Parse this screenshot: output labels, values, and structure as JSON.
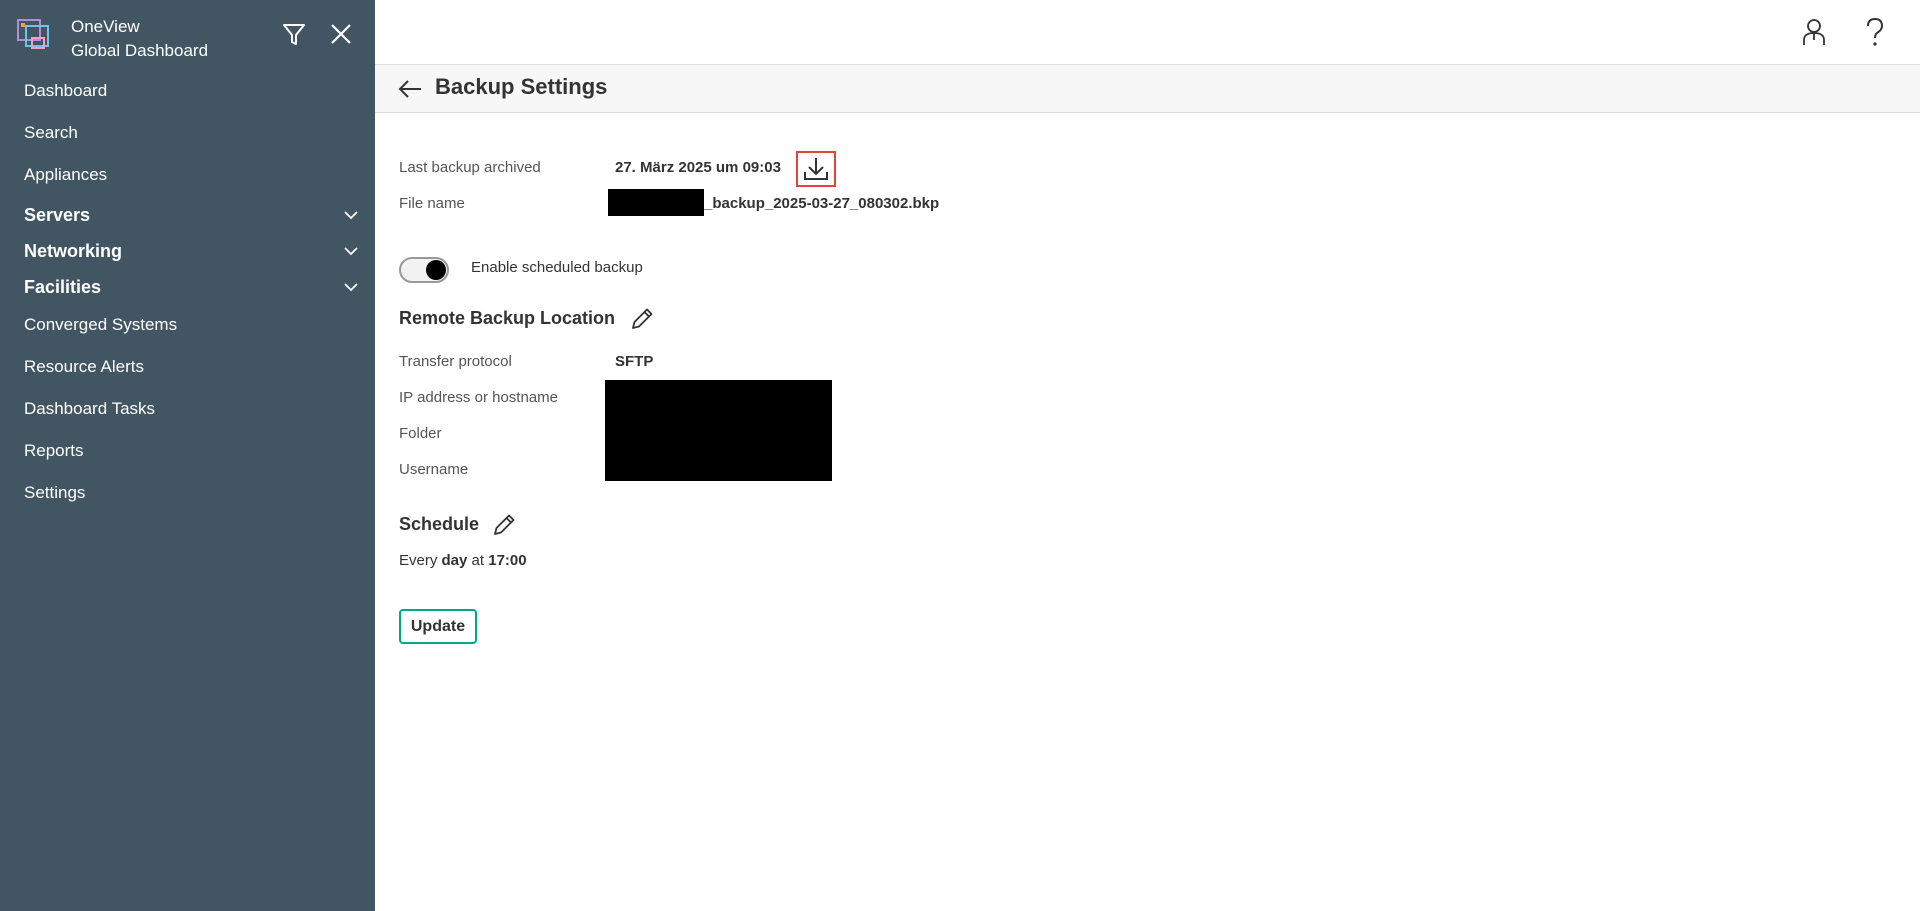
{
  "app": {
    "name_line1": "OneView",
    "name_line2": "Global Dashboard"
  },
  "sidebar": {
    "items": [
      {
        "label": "Dashboard"
      },
      {
        "label": "Search"
      },
      {
        "label": "Appliances"
      },
      {
        "label": "Servers"
      },
      {
        "label": "Networking"
      },
      {
        "label": "Facilities"
      },
      {
        "label": "Converged Systems"
      },
      {
        "label": "Resource Alerts"
      },
      {
        "label": "Dashboard Tasks"
      },
      {
        "label": "Reports"
      },
      {
        "label": "Settings"
      }
    ]
  },
  "page": {
    "title": "Backup Settings"
  },
  "backup": {
    "last_label": "Last backup archived",
    "last_value": "27. März 2025 um 09:03",
    "file_label": "File name",
    "file_suffix": "_backup_2025-03-27_080302.bkp",
    "toggle_label": "Enable scheduled backup",
    "toggle_on": true
  },
  "remote": {
    "title": "Remote Backup Location",
    "protocol_label": "Transfer protocol",
    "protocol_value": "SFTP",
    "host_label": "IP address or hostname",
    "folder_label": "Folder",
    "username_label": "Username"
  },
  "schedule": {
    "title": "Schedule",
    "prefix": "Every",
    "frequency": "day",
    "middle": "at",
    "time": "17:00"
  },
  "actions": {
    "update_label": "Update"
  },
  "colors": {
    "sidebar_bg": "#425563",
    "accent": "#01a982",
    "highlight": "#e4443a"
  }
}
